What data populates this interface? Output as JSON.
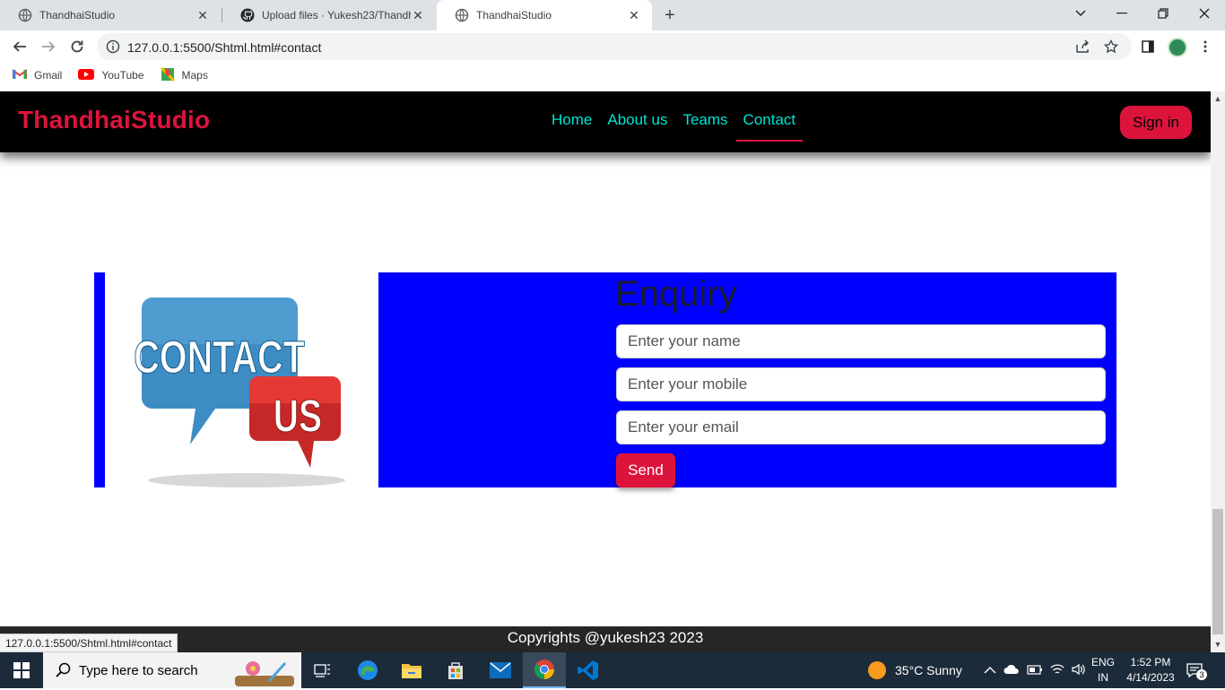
{
  "browser": {
    "tabs": [
      {
        "title": "ThandhaiStudio",
        "icon": "globe-icon",
        "active": false
      },
      {
        "title": "Upload files · Yukesh23/Thandhai",
        "icon": "github-icon",
        "active": false
      },
      {
        "title": "ThandhaiStudio",
        "icon": "globe-icon",
        "active": true
      }
    ],
    "new_tab_label": "+",
    "url": "127.0.0.1:5500/Shtml.html#contact",
    "bookmarks": [
      {
        "label": "Gmail",
        "icon": "gmail-icon"
      },
      {
        "label": "YouTube",
        "icon": "youtube-icon"
      },
      {
        "label": "Maps",
        "icon": "maps-icon"
      }
    ]
  },
  "site": {
    "brand": "ThandhaiStudio",
    "nav": [
      "Home",
      "About us",
      "Teams",
      "Contact"
    ],
    "active_nav": "Contact",
    "signin_label": "Sign in",
    "contact_image_text": {
      "line1": "CONTACT",
      "line2": "US"
    },
    "enquiry_title": "Enquiry",
    "fields": {
      "name_placeholder": "Enter your name",
      "mobile_placeholder": "Enter your mobile",
      "email_placeholder": "Enter your email"
    },
    "send_label": "Send",
    "footer": "Copyrights @yukesh23 2023",
    "colors": {
      "accent": "#dc143c",
      "nav_link": "#00e5d4",
      "panel": "#0000ff",
      "header": "#000000"
    }
  },
  "status_url": "127.0.0.1:5500/Shtml.html#contact",
  "taskbar": {
    "search_placeholder": "Type here to search",
    "weather": "35°C  Sunny",
    "lang_line1": "ENG",
    "lang_line2": "IN",
    "time": "1:52 PM",
    "date": "4/14/2023",
    "notification_count": "3"
  }
}
